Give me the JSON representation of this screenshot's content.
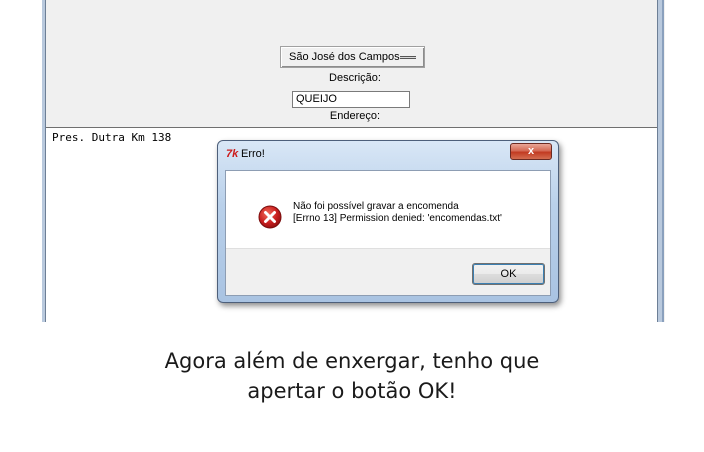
{
  "app": {
    "city_select": "São José dos Campos",
    "descricao_label": "Descrição:",
    "descricao_value": "QUEIJO",
    "endereco_label": "Endereço:",
    "endereco_text": "Pres. Dutra Km 138"
  },
  "dialog": {
    "title": "Erro!",
    "app_icon_glyph": "7k",
    "close_glyph": "x",
    "message_line1": "Não foi possível gravar a encomenda",
    "message_line2": "[Errno 13] Permission denied: 'encomendas.txt'",
    "ok_label": "OK",
    "icon": "error-icon"
  },
  "caption": {
    "line1": "Agora além de enxergar, tenho que",
    "line2": "apertar o botão OK!"
  }
}
